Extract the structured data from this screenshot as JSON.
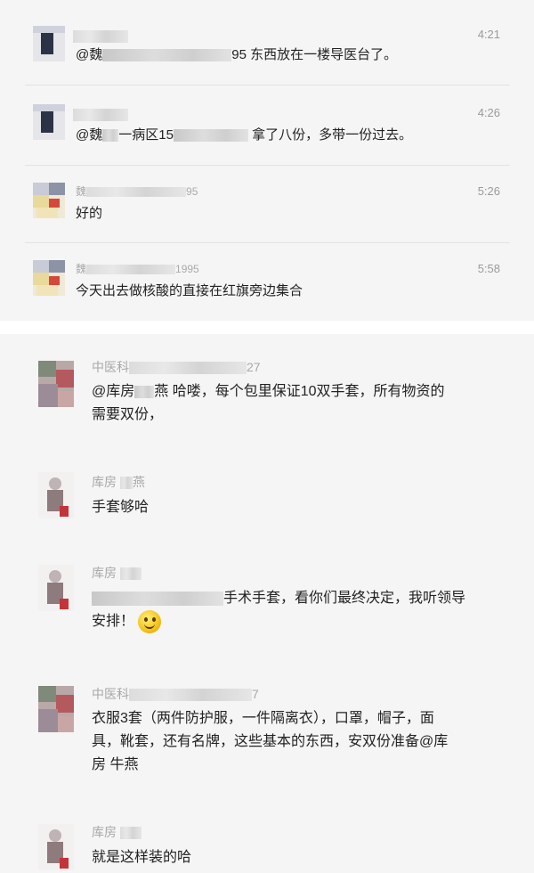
{
  "top_panel": {
    "messages": [
      {
        "name": "",
        "time": "4:21",
        "text_prefix": "@魏",
        "text_suffix": "95 东西放在一楼导医台了。"
      },
      {
        "name": "",
        "time": "4:26",
        "text_prefix": "@魏",
        "text_mid": "一病区15",
        "text_suffix": "拿了八份，多带一份过去。"
      },
      {
        "name_prefix": "魏",
        "name_suffix": "95",
        "time": "5:26",
        "text": "好的"
      },
      {
        "name_prefix": "魏",
        "name_suffix": "1995",
        "time": "5:58",
        "text": "今天出去做核酸的直接在红旗旁边集合"
      }
    ]
  },
  "bottom_panel": {
    "messages": [
      {
        "name_prefix": "中医科",
        "name_suffix": "27",
        "text_prefix": "@库房",
        "text_mid": "燕 哈喽，每个包里保证10双手套，所有物资的",
        "line2": "需要双份，"
      },
      {
        "name_prefix": "库房",
        "name_suffix": "燕",
        "text": "手套够哈"
      },
      {
        "name_prefix": "库房",
        "name_suffix": "燕",
        "line1_suffix": "手术手套，看你们最终决定，我听领导",
        "line2": "安排！"
      },
      {
        "name_prefix": "中医科",
        "name_suffix": "7",
        "line1": "衣服3套（两件防护服，一件隔离衣），口罩，帽子，面",
        "line2": "具，靴套，还有名牌，这些基本的东西，安双份准备@库",
        "line3": "房 牛燕"
      },
      {
        "name_prefix": "库房",
        "name_suffix": "燕",
        "text": "就是这样装的哈"
      }
    ]
  },
  "icons": {
    "smile": "smile-emoji-icon"
  }
}
